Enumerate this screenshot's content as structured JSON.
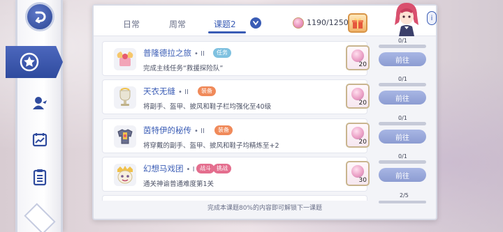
{
  "tabs": [
    {
      "label": "日常"
    },
    {
      "label": "周常"
    },
    {
      "label": "课题2"
    }
  ],
  "active_tab": "课题2",
  "points": {
    "value": "1190/1250"
  },
  "info_label": "i",
  "quests": [
    {
      "title": "普隆德拉之旅",
      "level": "II",
      "tags": [
        "任务"
      ],
      "desc": "完成主线任务“救援探险队”",
      "reward_qty": "20",
      "progress": "0/1",
      "progress_fraction": 0,
      "button": "前往"
    },
    {
      "title": "天衣无缝",
      "level": "II",
      "tags": [
        "装备"
      ],
      "desc": "将副手、盔甲、披风和鞋子栏均强化至40级",
      "reward_qty": "20",
      "progress": "0/1",
      "progress_fraction": 0,
      "button": "前往"
    },
    {
      "title": "茵特伊的秘传",
      "level": "II",
      "tags": [
        "装备"
      ],
      "desc": "将穿戴的副手、盔甲、披风和鞋子均精炼至+2",
      "reward_qty": "20",
      "progress": "0/1",
      "progress_fraction": 0,
      "button": "前往"
    },
    {
      "title": "幻想马戏团",
      "level": "I",
      "tags": [
        "战斗",
        "挑战"
      ],
      "desc": "通关神谕普通难度第1关",
      "reward_qty": "30",
      "progress": "0/1",
      "progress_fraction": 0,
      "button": "前往"
    }
  ],
  "next_progress": "2/5",
  "footer_hint": "完成本课题80%的内容即可解锁下一课题",
  "colors": {
    "accent": "#3a5cb5",
    "task_tag": "#7fc1e0",
    "equip_tag": "#f08a5a",
    "battle_tag": "#e46e8e"
  }
}
